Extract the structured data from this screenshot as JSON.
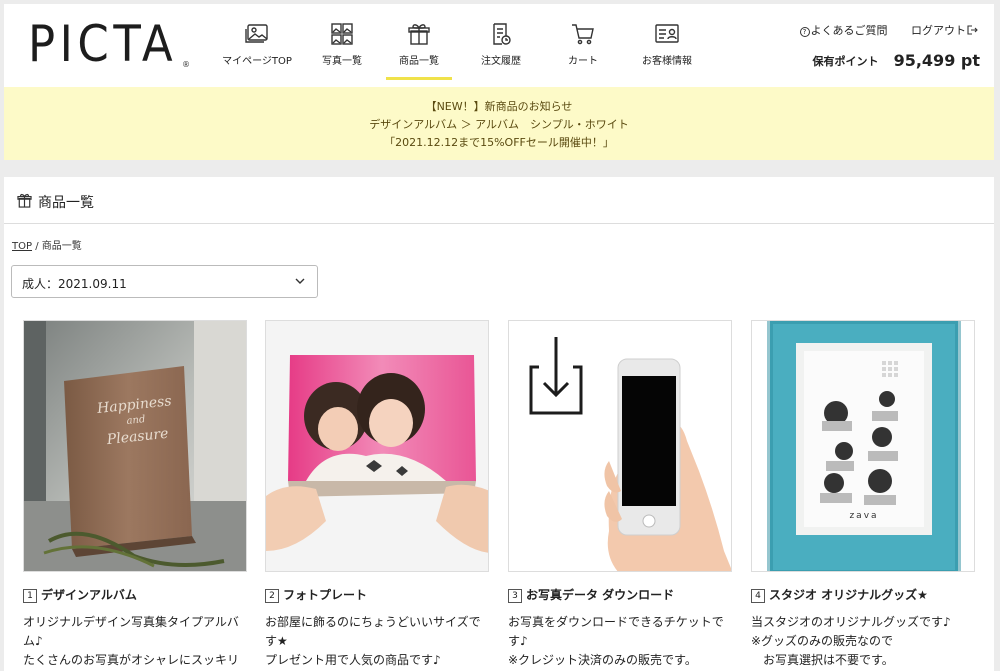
{
  "header": {
    "logo": "PICTA",
    "logo_reg": "®",
    "nav": [
      {
        "label": "マイページTOP",
        "icon": "image-icon"
      },
      {
        "label": "写真一覧",
        "icon": "photo-grid-icon"
      },
      {
        "label": "商品一覧",
        "icon": "gift-icon"
      },
      {
        "label": "注文履歴",
        "icon": "order-history-icon"
      },
      {
        "label": "カート",
        "icon": "cart-icon"
      },
      {
        "label": "お客様情報",
        "icon": "customer-info-icon"
      }
    ],
    "faq_label": "よくあるご質問",
    "logout_label": "ログアウト",
    "points_label": "保有ポイント",
    "points_value": "95,499 pt"
  },
  "notice": {
    "line1": "【NEW！】新商品のお知らせ",
    "line2": "デザインアルバム ＞ アルバム　シンプル・ホワイト",
    "line3": "「2021.12.12まで15%OFFセール開催中！」"
  },
  "page": {
    "title": "商品一覧",
    "breadcrumb_top": "TOP",
    "breadcrumb_sep": "/",
    "breadcrumb_current": "商品一覧",
    "event_select": "成人：2021.09.11"
  },
  "products": [
    {
      "num": "1",
      "title": "デザインアルバム",
      "desc": [
        "オリジナルデザイン写真集タイプアルバ",
        "ム♪",
        "たくさんのお写真がオシャレにスッキリ"
      ],
      "album_text": [
        "Happiness",
        "and",
        "Pleasure"
      ]
    },
    {
      "num": "2",
      "title": "フォトプレート",
      "desc": [
        "お部屋に飾るのにちょうどいいサイズで",
        "す★",
        "プレゼント用で人気の商品です♪"
      ]
    },
    {
      "num": "3",
      "title": "お写真データ ダウンロード",
      "desc": [
        "お写真をダウンロードできるチケットで",
        "す♪",
        "※クレジット決済のみの販売です。"
      ]
    },
    {
      "num": "4",
      "title": "スタジオ オリジナルグッズ★",
      "desc": [
        "当スタジオのオリジナルグッズです♪",
        "※グッズのみの販売なので",
        "　お写真選択は不要です。"
      ],
      "frame_text": "zava"
    }
  ]
}
